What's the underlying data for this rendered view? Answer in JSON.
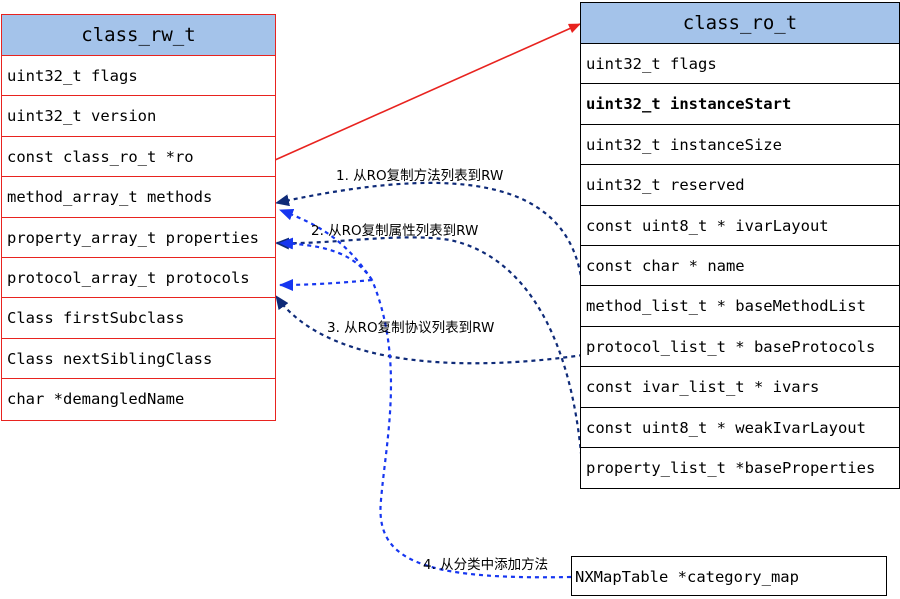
{
  "class_rw_t": {
    "title": "class_rw_t",
    "fields": [
      "uint32_t flags",
      "uint32_t version",
      "const class_ro_t *ro",
      "method_array_t methods",
      "property_array_t properties",
      "protocol_array_t protocols",
      "Class firstSubclass",
      "Class nextSiblingClass",
      "char *demangledName"
    ]
  },
  "class_ro_t": {
    "title": "class_ro_t",
    "fields": [
      "uint32_t flags",
      "uint32_t instanceStart",
      "uint32_t instanceSize",
      "uint32_t reserved",
      "const uint8_t * ivarLayout",
      "const char * name",
      "method_list_t * baseMethodList",
      "protocol_list_t * baseProtocols",
      "const ivar_list_t * ivars",
      "const uint8_t * weakIvarLayout",
      "property_list_t *baseProperties"
    ]
  },
  "category_map": "NXMapTable *category_map",
  "labels": {
    "copy_methods": "1. 从RO复制方法列表到RW",
    "copy_properties": "2. 从RO复制属性列表到RW",
    "copy_protocols": "3. 从RO复制协议列表到RW",
    "add_from_category": "4. 从分类中添加方法"
  },
  "colors": {
    "header_fill": "#a4c3ea",
    "rw_border": "#e8231f",
    "ro_arrow": "#e8231f",
    "copy_arrow": "#0e2a78",
    "category_arrow": "#1636f0"
  }
}
